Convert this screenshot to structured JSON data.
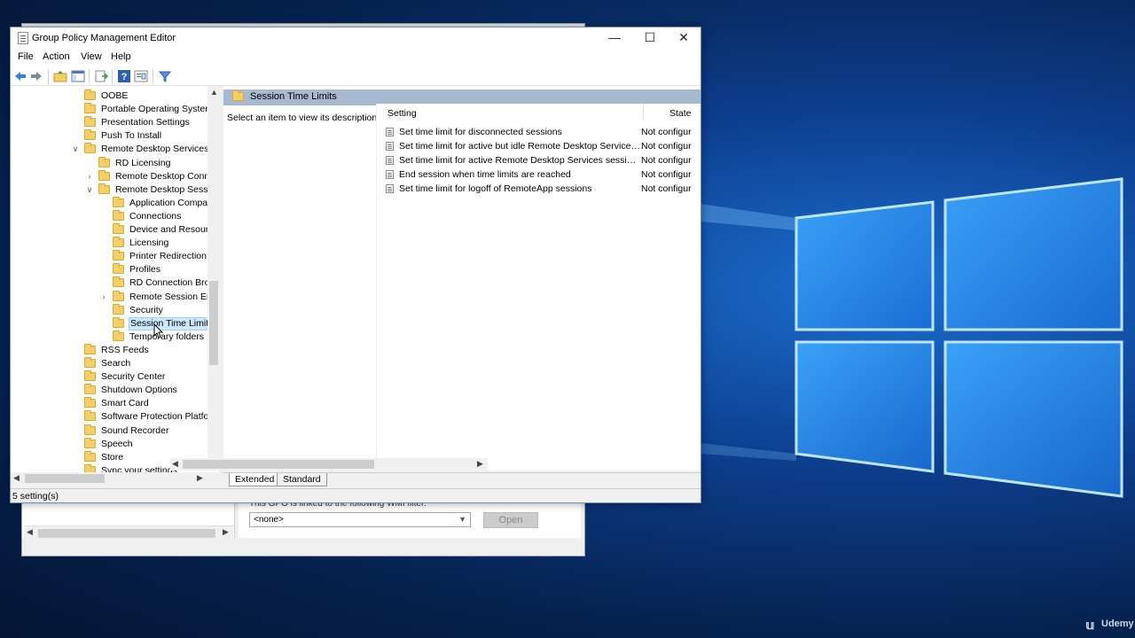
{
  "window": {
    "title": "Group Policy Management Editor",
    "minimize": "—",
    "maximize": "☐",
    "close": "✕"
  },
  "menu": [
    "File",
    "Action",
    "View",
    "Help"
  ],
  "tree": {
    "items": [
      {
        "label": "OOBE",
        "level": 0,
        "expander": ""
      },
      {
        "label": "Portable Operating System",
        "level": 0,
        "expander": ""
      },
      {
        "label": "Presentation Settings",
        "level": 0,
        "expander": ""
      },
      {
        "label": "Push To Install",
        "level": 0,
        "expander": ""
      },
      {
        "label": "Remote Desktop Services",
        "level": 0,
        "expander": "expanded"
      },
      {
        "label": "RD Licensing",
        "level": 1,
        "expander": ""
      },
      {
        "label": "Remote Desktop Conne",
        "level": 1,
        "expander": "collapsed"
      },
      {
        "label": "Remote Desktop Sessio",
        "level": 1,
        "expander": "expanded"
      },
      {
        "label": "Application Compat",
        "level": 2,
        "expander": ""
      },
      {
        "label": "Connections",
        "level": 2,
        "expander": ""
      },
      {
        "label": "Device and Resourc",
        "level": 2,
        "expander": ""
      },
      {
        "label": "Licensing",
        "level": 2,
        "expander": ""
      },
      {
        "label": "Printer Redirection",
        "level": 2,
        "expander": ""
      },
      {
        "label": "Profiles",
        "level": 2,
        "expander": ""
      },
      {
        "label": "RD Connection Brok",
        "level": 2,
        "expander": ""
      },
      {
        "label": "Remote Session Env",
        "level": 2,
        "expander": "collapsed"
      },
      {
        "label": "Security",
        "level": 2,
        "expander": ""
      },
      {
        "label": "Session Time Limits",
        "level": 2,
        "expander": "",
        "selected": true
      },
      {
        "label": "Temporary folders",
        "level": 2,
        "expander": ""
      },
      {
        "label": "RSS Feeds",
        "level": 0,
        "expander": ""
      },
      {
        "label": "Search",
        "level": 0,
        "expander": ""
      },
      {
        "label": "Security Center",
        "level": 0,
        "expander": ""
      },
      {
        "label": "Shutdown Options",
        "level": 0,
        "expander": ""
      },
      {
        "label": "Smart Card",
        "level": 0,
        "expander": ""
      },
      {
        "label": "Software Protection Platfor",
        "level": 0,
        "expander": ""
      },
      {
        "label": "Sound Recorder",
        "level": 0,
        "expander": ""
      },
      {
        "label": "Speech",
        "level": 0,
        "expander": ""
      },
      {
        "label": "Store",
        "level": 0,
        "expander": ""
      },
      {
        "label": "Sync your settings",
        "level": 0,
        "expander": ""
      }
    ]
  },
  "right": {
    "header": "Session Time Limits",
    "description": "Select an item to view its description.",
    "columns": {
      "setting": "Setting",
      "state": "State"
    },
    "rows": [
      {
        "name": "Set time limit for disconnected sessions",
        "state": "Not configur"
      },
      {
        "name": "Set time limit for active but idle Remote Desktop Services se...",
        "state": "Not configur"
      },
      {
        "name": "Set time limit for active Remote Desktop Services sessions",
        "state": "Not configur"
      },
      {
        "name": "End session when time limits are reached",
        "state": "Not configur"
      },
      {
        "name": "Set time limit for logoff of RemoteApp sessions",
        "state": "Not configur"
      }
    ]
  },
  "tabs": {
    "extended": "Extended",
    "standard": "Standard"
  },
  "status": "5 setting(s)",
  "back_window": {
    "wmi_text": "This GPO is linked to the following WMI filter:",
    "wmi_select": "<none>",
    "open_button": "Open"
  },
  "watermark": "Udemy",
  "colors": {
    "accent_header": "#a7b9cf",
    "selection": "#cce8ff",
    "desktop": "#0d3f8f"
  }
}
